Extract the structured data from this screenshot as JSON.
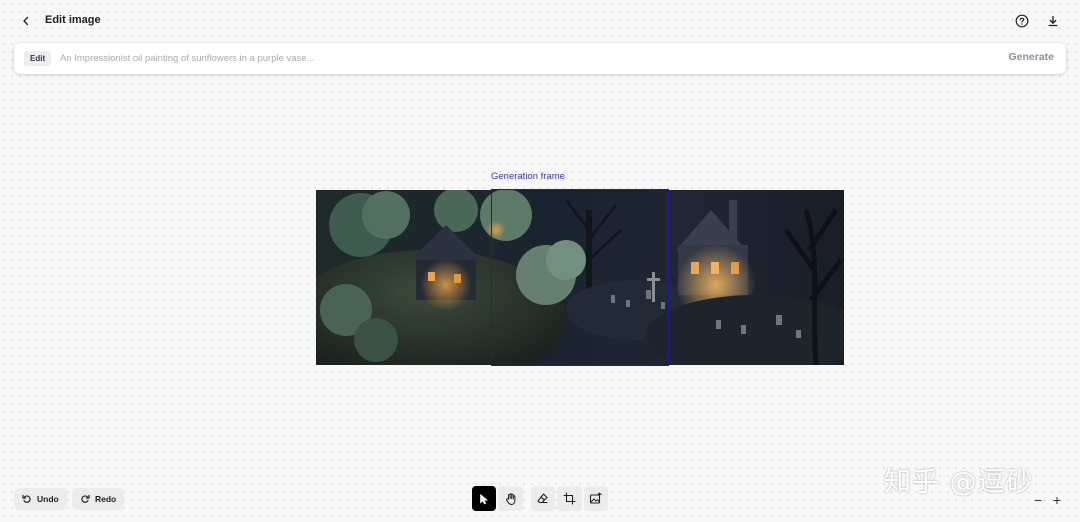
{
  "header": {
    "title": "Edit image",
    "back_icon": "chevron-left-icon",
    "help_icon": "question-circle-icon",
    "download_icon": "download-icon"
  },
  "prompt": {
    "mode_badge": "Edit",
    "placeholder": "An Impressionist oil painting of sunflowers in a purple vase...",
    "value": "",
    "generate_label": "Generate"
  },
  "canvas": {
    "frame_label": "Generation frame",
    "frame_color": "#1f1aa0"
  },
  "history": {
    "undo_label": "Undo",
    "redo_label": "Redo"
  },
  "tools": [
    {
      "name": "select",
      "icon": "cursor-icon",
      "active": true
    },
    {
      "name": "pan",
      "icon": "hand-icon",
      "active": false
    },
    {
      "name": "erase",
      "icon": "eraser-icon",
      "active": false
    },
    {
      "name": "add-frame",
      "icon": "frame-icon",
      "active": false
    },
    {
      "name": "upload-image",
      "icon": "image-upload-icon",
      "active": false
    }
  ],
  "zoom": {
    "out_label": "−",
    "in_label": "+"
  },
  "watermark": "知乎 @逗砂"
}
